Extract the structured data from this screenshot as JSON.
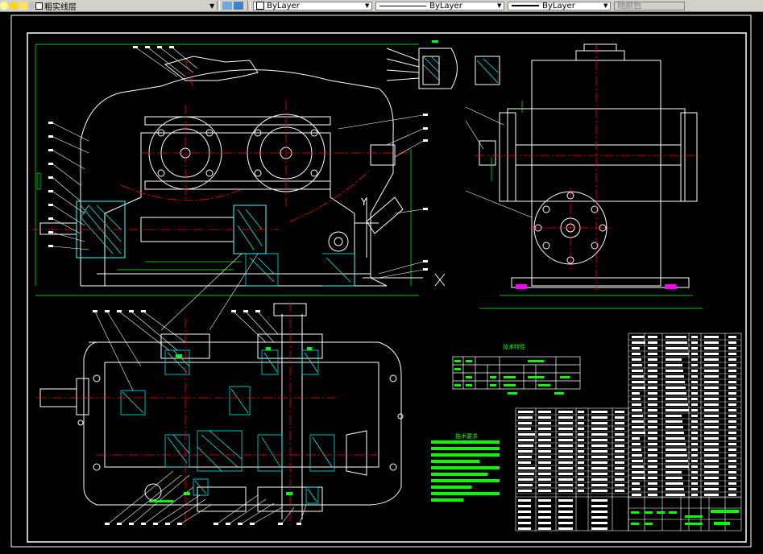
{
  "toolbar": {
    "layer_name": "粗实线层",
    "color_value": "ByLayer",
    "linetype_value": "ByLayer",
    "lineweight_value": "ByLayer",
    "plotstyle_value": "随颜色"
  },
  "drawing": {
    "tech_table_title": "技术特性",
    "tech_req_title": "技术要求",
    "axis_y_label": "Y",
    "axis_x_label": "X"
  },
  "colors": {
    "background": "#000000",
    "outline": "#ffffff",
    "centerline": "#ff0000",
    "hatch": "#00ffff",
    "text": "#00ff00",
    "dimension": "#00ff00"
  }
}
